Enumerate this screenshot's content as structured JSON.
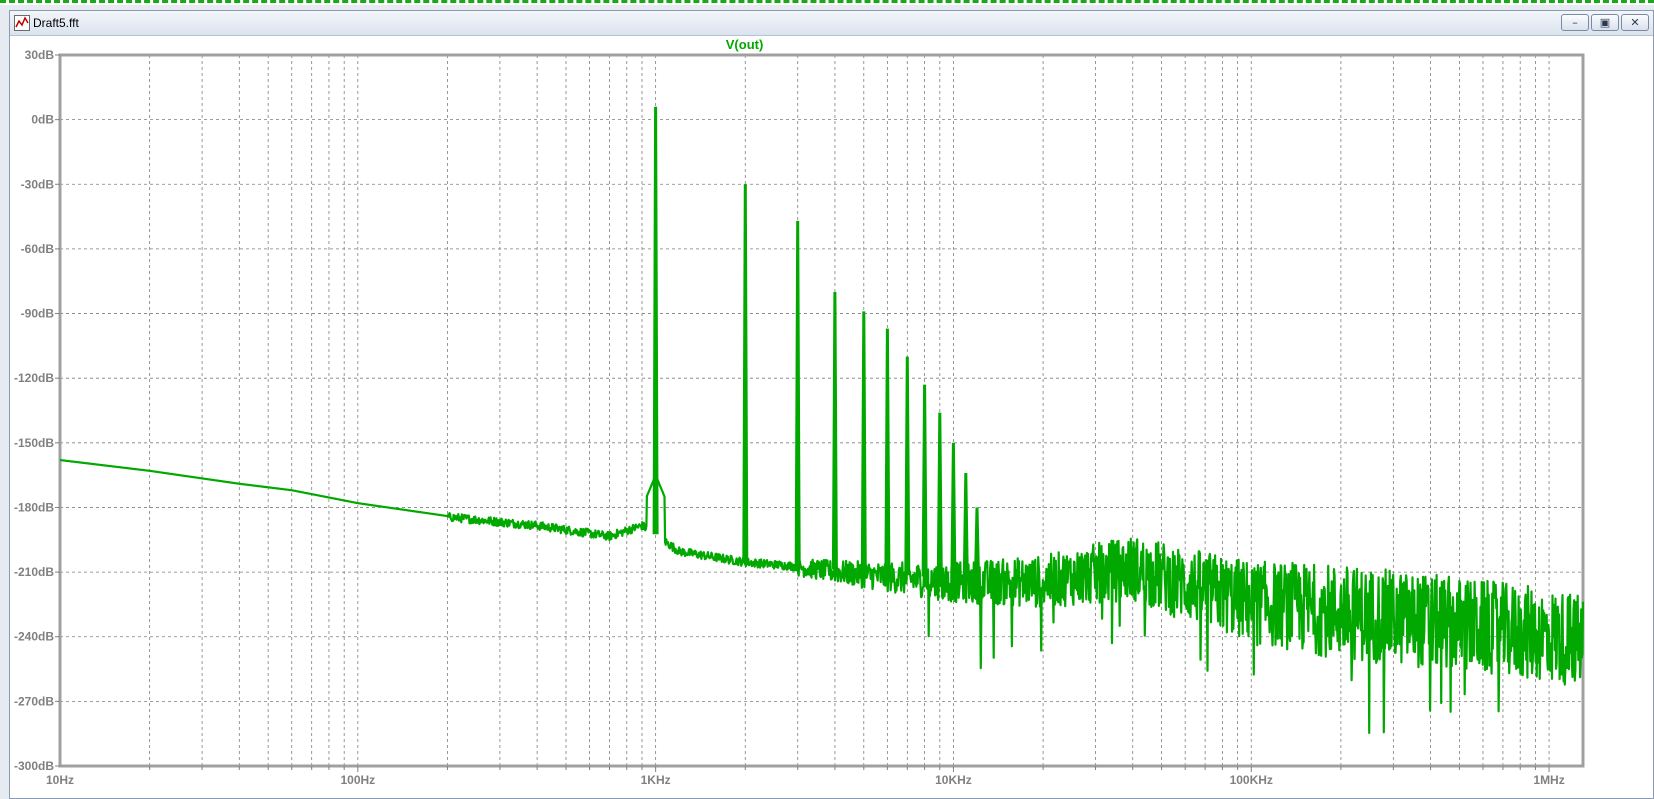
{
  "window": {
    "title": "Draft5.fft",
    "icon": "waveform-icon",
    "controls": [
      "minimize-icon",
      "restore-icon",
      "close-icon"
    ]
  },
  "colors": {
    "trace": "#00a800",
    "grid": "#7f7f7f",
    "axis_text": "#808080",
    "frame": "#a0a0a0",
    "background": "#ffffff"
  },
  "chart_data": {
    "type": "line",
    "title": "V(out)",
    "x_scale": "log",
    "x_unit": "Hz",
    "xlim": [
      10,
      1300000
    ],
    "ylim": [
      -300,
      30
    ],
    "y_unit": "dB",
    "grid": true,
    "x_tick_labels": [
      "10Hz",
      "100Hz",
      "1KHz",
      "10KHz",
      "100KHz",
      "1MHz"
    ],
    "x_tick_values": [
      10,
      100,
      1000,
      10000,
      100000,
      1000000
    ],
    "y_tick_labels": [
      "30dB",
      "0dB",
      "-30dB",
      "-60dB",
      "-90dB",
      "-120dB",
      "-150dB",
      "-180dB",
      "-210dB",
      "-240dB",
      "-270dB",
      "-300dB"
    ],
    "y_tick_values": [
      30,
      0,
      -30,
      -60,
      -90,
      -120,
      -150,
      -180,
      -210,
      -240,
      -270,
      -300
    ],
    "series": [
      {
        "name": "V(out)",
        "noise_floor": {
          "x": [
            10,
            20,
            40,
            60,
            100,
            200,
            400,
            700,
            900,
            1200,
            2000,
            3000,
            5000,
            10000,
            20000,
            40000,
            60000,
            100000,
            200000,
            500000,
            1000000,
            1300000
          ],
          "y": [
            -158,
            -163,
            -169,
            -172,
            -178,
            -184,
            -188,
            -193,
            -188,
            -200,
            -205,
            -207,
            -210,
            -213,
            -212,
            -205,
            -212,
            -220,
            -224,
            -230,
            -235,
            -238
          ]
        },
        "harmonics": {
          "x": [
            1000,
            2000,
            3000,
            4000,
            5000,
            6000,
            7000,
            8000,
            9000,
            10000,
            11000,
            12000
          ],
          "y": [
            6,
            -30,
            -47,
            -80,
            -89,
            -97,
            -110,
            -123,
            -136,
            -150,
            -164,
            -180
          ]
        }
      }
    ]
  }
}
